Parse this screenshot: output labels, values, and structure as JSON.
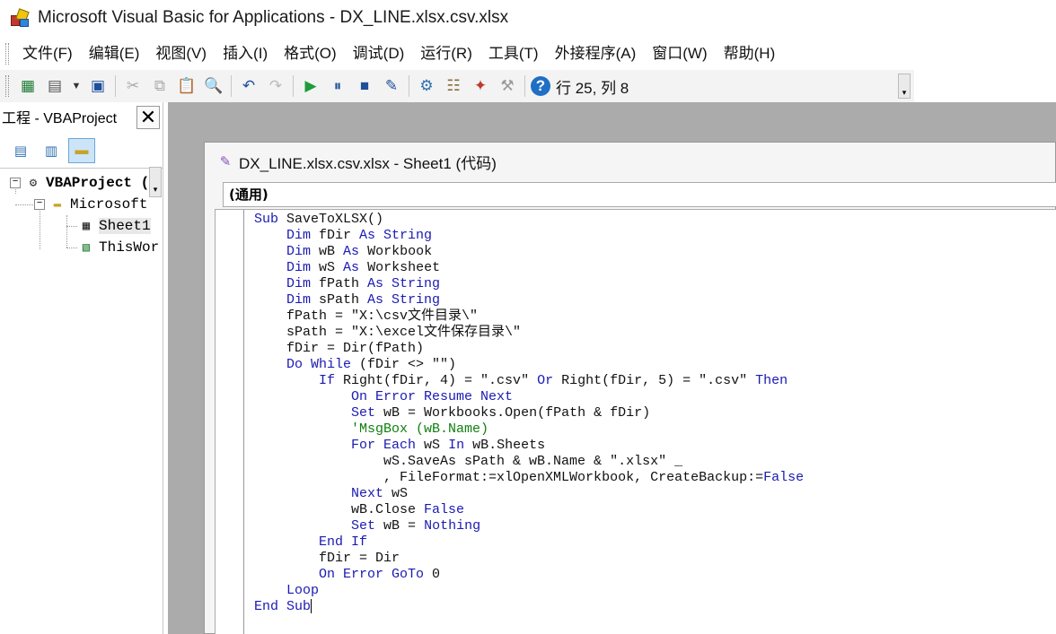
{
  "window": {
    "title": "Microsoft Visual Basic for Applications - DX_LINE.xlsx.csv.xlsx"
  },
  "menu": [
    {
      "label": "文件(F)",
      "name": "menu-file"
    },
    {
      "label": "编辑(E)",
      "name": "menu-edit"
    },
    {
      "label": "视图(V)",
      "name": "menu-view"
    },
    {
      "label": "插入(I)",
      "name": "menu-insert"
    },
    {
      "label": "格式(O)",
      "name": "menu-format"
    },
    {
      "label": "调试(D)",
      "name": "menu-debug"
    },
    {
      "label": "运行(R)",
      "name": "menu-run"
    },
    {
      "label": "工具(T)",
      "name": "menu-tools"
    },
    {
      "label": "外接程序(A)",
      "name": "menu-addins"
    },
    {
      "label": "窗口(W)",
      "name": "menu-window"
    },
    {
      "label": "帮助(H)",
      "name": "menu-help"
    }
  ],
  "toolbar": {
    "buttons": [
      {
        "icon": "excel-view-icon",
        "glyph": "▦",
        "color": "#1e7b34"
      },
      {
        "icon": "insert-form-icon",
        "glyph": "▤",
        "color": "#555555"
      },
      {
        "icon": "dropdown-arrow-icon",
        "glyph": "▼",
        "color": "#333333"
      },
      {
        "icon": "save-icon",
        "glyph": "▣",
        "color": "#1f4e9a"
      },
      {
        "sep": true
      },
      {
        "icon": "cut-icon",
        "glyph": "✂",
        "color": "#aaaaaa"
      },
      {
        "icon": "copy-icon",
        "glyph": "⧉",
        "color": "#aaaaaa"
      },
      {
        "icon": "paste-icon",
        "glyph": "📋",
        "color": "#8a6d3b"
      },
      {
        "icon": "find-icon",
        "glyph": "🔍",
        "color": "#333333"
      },
      {
        "sep": true
      },
      {
        "icon": "undo-icon",
        "glyph": "↶",
        "color": "#1f4e9a"
      },
      {
        "icon": "redo-icon",
        "glyph": "↷",
        "color": "#bbbbbb"
      },
      {
        "sep": true
      },
      {
        "icon": "run-icon",
        "glyph": "▶",
        "color": "#1e9b3a"
      },
      {
        "icon": "pause-icon",
        "glyph": "⏸",
        "color": "#1f4e9a"
      },
      {
        "icon": "stop-icon",
        "glyph": "■",
        "color": "#1f4e9a"
      },
      {
        "icon": "design-mode-icon",
        "glyph": "✎",
        "color": "#1f4e9a"
      },
      {
        "sep": true
      },
      {
        "icon": "project-explorer-icon",
        "glyph": "⚙",
        "color": "#2e6fb0"
      },
      {
        "icon": "properties-icon",
        "glyph": "☷",
        "color": "#8a6d3b"
      },
      {
        "icon": "object-browser-icon",
        "glyph": "✦",
        "color": "#c0392b"
      },
      {
        "icon": "toolbox-icon",
        "glyph": "⚒",
        "color": "#999999"
      },
      {
        "sep": true
      },
      {
        "icon": "help-icon",
        "glyph": "?",
        "color": "#ffffff"
      }
    ],
    "status": "行 25, 列 8"
  },
  "project": {
    "title": "工程 - VBAProject",
    "tree": {
      "root": "VBAProject (",
      "folder": "Microsoft",
      "items": [
        "Sheet1",
        "ThisWor"
      ]
    }
  },
  "code_window": {
    "title": "DX_LINE.xlsx.csv.xlsx - Sheet1 (代码)",
    "object_dropdown": "(通用)",
    "lines": [
      [
        {
          "t": "Sub ",
          "k": 1
        },
        {
          "t": "SaveToXLSX()"
        }
      ],
      [
        {
          "t": "    "
        },
        {
          "t": "Dim ",
          "k": 1
        },
        {
          "t": "fDir "
        },
        {
          "t": "As String",
          "k": 1
        }
      ],
      [
        {
          "t": "    "
        },
        {
          "t": "Dim ",
          "k": 1
        },
        {
          "t": "wB "
        },
        {
          "t": "As ",
          "k": 1
        },
        {
          "t": "Workbook"
        }
      ],
      [
        {
          "t": "    "
        },
        {
          "t": "Dim ",
          "k": 1
        },
        {
          "t": "wS "
        },
        {
          "t": "As ",
          "k": 1
        },
        {
          "t": "Worksheet"
        }
      ],
      [
        {
          "t": "    "
        },
        {
          "t": "Dim ",
          "k": 1
        },
        {
          "t": "fPath "
        },
        {
          "t": "As String",
          "k": 1
        }
      ],
      [
        {
          "t": "    "
        },
        {
          "t": "Dim ",
          "k": 1
        },
        {
          "t": "sPath "
        },
        {
          "t": "As String",
          "k": 1
        }
      ],
      [
        {
          "t": "    fPath = \"X:\\csv文件目录\\\""
        }
      ],
      [
        {
          "t": "    sPath = \"X:\\excel文件保存目录\\\""
        }
      ],
      [
        {
          "t": "    fDir = Dir(fPath)"
        }
      ],
      [
        {
          "t": "    "
        },
        {
          "t": "Do While",
          "k": 1
        },
        {
          "t": " (fDir <> \"\")"
        }
      ],
      [
        {
          "t": "        "
        },
        {
          "t": "If ",
          "k": 1
        },
        {
          "t": "Right(fDir, 4) = \".csv\" "
        },
        {
          "t": "Or ",
          "k": 1
        },
        {
          "t": "Right(fDir, 5) = \".csv\" "
        },
        {
          "t": "Then",
          "k": 1
        }
      ],
      [
        {
          "t": "            "
        },
        {
          "t": "On Error Resume Next",
          "k": 1
        }
      ],
      [
        {
          "t": "            "
        },
        {
          "t": "Set ",
          "k": 1
        },
        {
          "t": "wB = Workbooks.Open(fPath & fDir)"
        }
      ],
      [
        {
          "t": "            "
        },
        {
          "t": "'MsgBox (wB.Name)",
          "c": 1
        }
      ],
      [
        {
          "t": "            "
        },
        {
          "t": "For Each ",
          "k": 1
        },
        {
          "t": "wS "
        },
        {
          "t": "In ",
          "k": 1
        },
        {
          "t": "wB.Sheets"
        }
      ],
      [
        {
          "t": "                wS.SaveAs sPath & wB.Name & \".xlsx\" _"
        }
      ],
      [
        {
          "t": "                , FileFormat:=xlOpenXMLWorkbook, CreateBackup:="
        },
        {
          "t": "False",
          "k": 1
        }
      ],
      [
        {
          "t": "            "
        },
        {
          "t": "Next ",
          "k": 1
        },
        {
          "t": "wS"
        }
      ],
      [
        {
          "t": "            wB.Close "
        },
        {
          "t": "False",
          "k": 1
        }
      ],
      [
        {
          "t": "            "
        },
        {
          "t": "Set ",
          "k": 1
        },
        {
          "t": "wB = "
        },
        {
          "t": "Nothing",
          "k": 1
        }
      ],
      [
        {
          "t": "        "
        },
        {
          "t": "End If",
          "k": 1
        }
      ],
      [
        {
          "t": "        fDir = Dir"
        }
      ],
      [
        {
          "t": "        "
        },
        {
          "t": "On Error GoTo ",
          "k": 1
        },
        {
          "t": "0"
        }
      ],
      [
        {
          "t": "    "
        },
        {
          "t": "Loop",
          "k": 1
        }
      ],
      [
        {
          "t": "End Sub",
          "k": 1
        }
      ]
    ]
  },
  "colors": {
    "keyword": "#1a1ab3",
    "comment": "#108010",
    "mdi_background": "#ababab"
  }
}
